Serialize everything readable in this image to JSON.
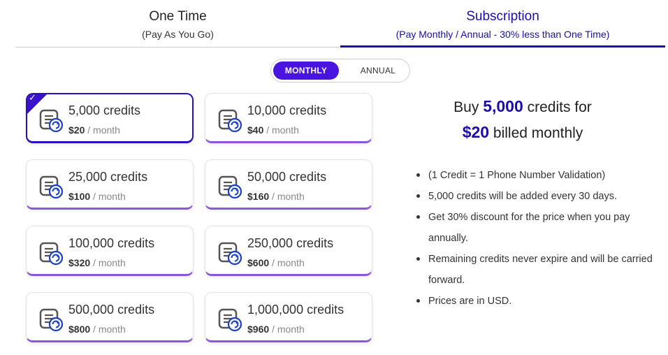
{
  "tabs": {
    "one_time": {
      "title": "One Time",
      "subtitle": "(Pay As You Go)"
    },
    "subscription": {
      "title": "Subscription",
      "subtitle": "(Pay Monthly / Annual - 30% less than One Time)"
    }
  },
  "toggle": {
    "monthly": "MONTHLY",
    "annual": "ANNUAL",
    "selected": "MONTHLY"
  },
  "plans": [
    {
      "credits": "5,000 credits",
      "price": "$20",
      "period": "/ month",
      "selected": true
    },
    {
      "credits": "10,000 credits",
      "price": "$40",
      "period": "/ month"
    },
    {
      "credits": "25,000 credits",
      "price": "$100",
      "period": "/ month"
    },
    {
      "credits": "50,000 credits",
      "price": "$160",
      "period": "/ month"
    },
    {
      "credits": "100,000 credits",
      "price": "$320",
      "period": "/ month"
    },
    {
      "credits": "250,000 credits",
      "price": "$600",
      "period": "/ month"
    },
    {
      "credits": "500,000 credits",
      "price": "$800",
      "period": "/ month"
    },
    {
      "credits": "1,000,000 credits",
      "price": "$960",
      "period": "/ month"
    }
  ],
  "summary": {
    "buy": "Buy",
    "credits_amount": "5,000",
    "credits_for": "credits for",
    "price": "$20",
    "billing": "billed monthly"
  },
  "bullets": [
    "(1 Credit = 1 Phone Number Validation)",
    "5,000 credits will be added every 30 days.",
    "Get 30% discount for the price when you pay annually.",
    "Remaining credits never expire and will be carried forward.",
    "Prices are in USD."
  ],
  "icons": {
    "plan": "credit-refresh-icon",
    "selected": "checkmark-icon"
  },
  "colors": {
    "accent": "#1a0dab",
    "toggle_active": "#4a14e0",
    "card_bottom": "#8a55e0",
    "selected_border": "#2b0fb8"
  }
}
